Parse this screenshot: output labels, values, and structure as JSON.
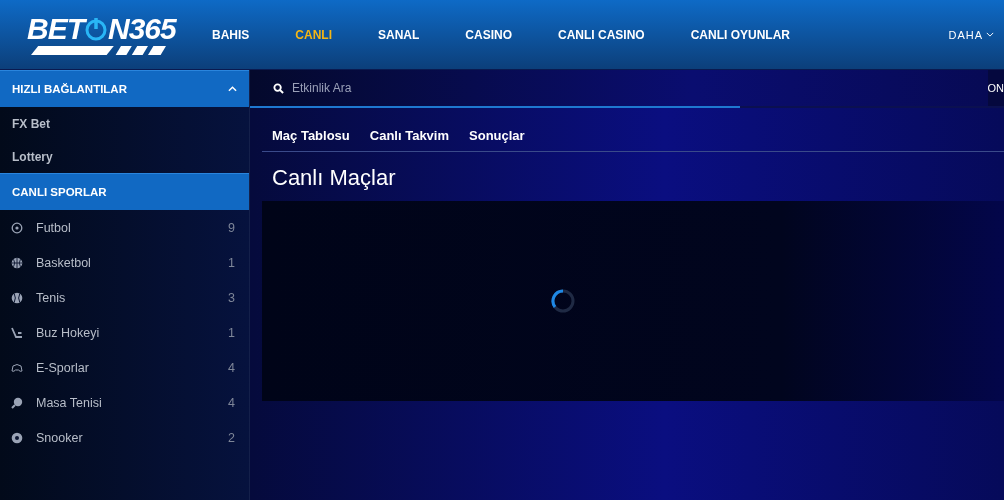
{
  "logo": {
    "left": "BET",
    "right": "N365"
  },
  "nav": [
    {
      "label": "BAHIS",
      "selected": false
    },
    {
      "label": "CANLI",
      "selected": true
    },
    {
      "label": "SANAL",
      "selected": false
    },
    {
      "label": "CASINO",
      "selected": false
    },
    {
      "label": "CANLI CASINO",
      "selected": false
    },
    {
      "label": "CANLI OYUNLAR",
      "selected": false
    }
  ],
  "more": "DAHA",
  "sidebar": {
    "quick_links": {
      "title": "HIZLI BAĞLANTILAR",
      "expanded": true,
      "items": [
        "FX Bet",
        "Lottery"
      ]
    },
    "live_title": "CANLI SPORLAR",
    "sports": [
      {
        "kind": "soccer",
        "name": "Futbol",
        "count": "9"
      },
      {
        "kind": "basketball",
        "name": "Basketbol",
        "count": "1"
      },
      {
        "kind": "tennis",
        "name": "Tenis",
        "count": "3"
      },
      {
        "kind": "hockey",
        "name": "Buz Hokeyi",
        "count": "1"
      },
      {
        "kind": "esports",
        "name": "E-Sporlar",
        "count": "4"
      },
      {
        "kind": "pingpong",
        "name": "Masa Tenisi",
        "count": "4"
      },
      {
        "kind": "snooker",
        "name": "Snooker",
        "count": "2"
      }
    ]
  },
  "search": {
    "placeholder": "Etkinlik Ara",
    "right_text": "ON",
    "progress": {
      "level": 0.65
    }
  },
  "tabs": [
    "Maç Tablosu",
    "Canlı Takvim",
    "Sonuçlar"
  ],
  "title": "Canlı Maçlar",
  "loading": true
}
